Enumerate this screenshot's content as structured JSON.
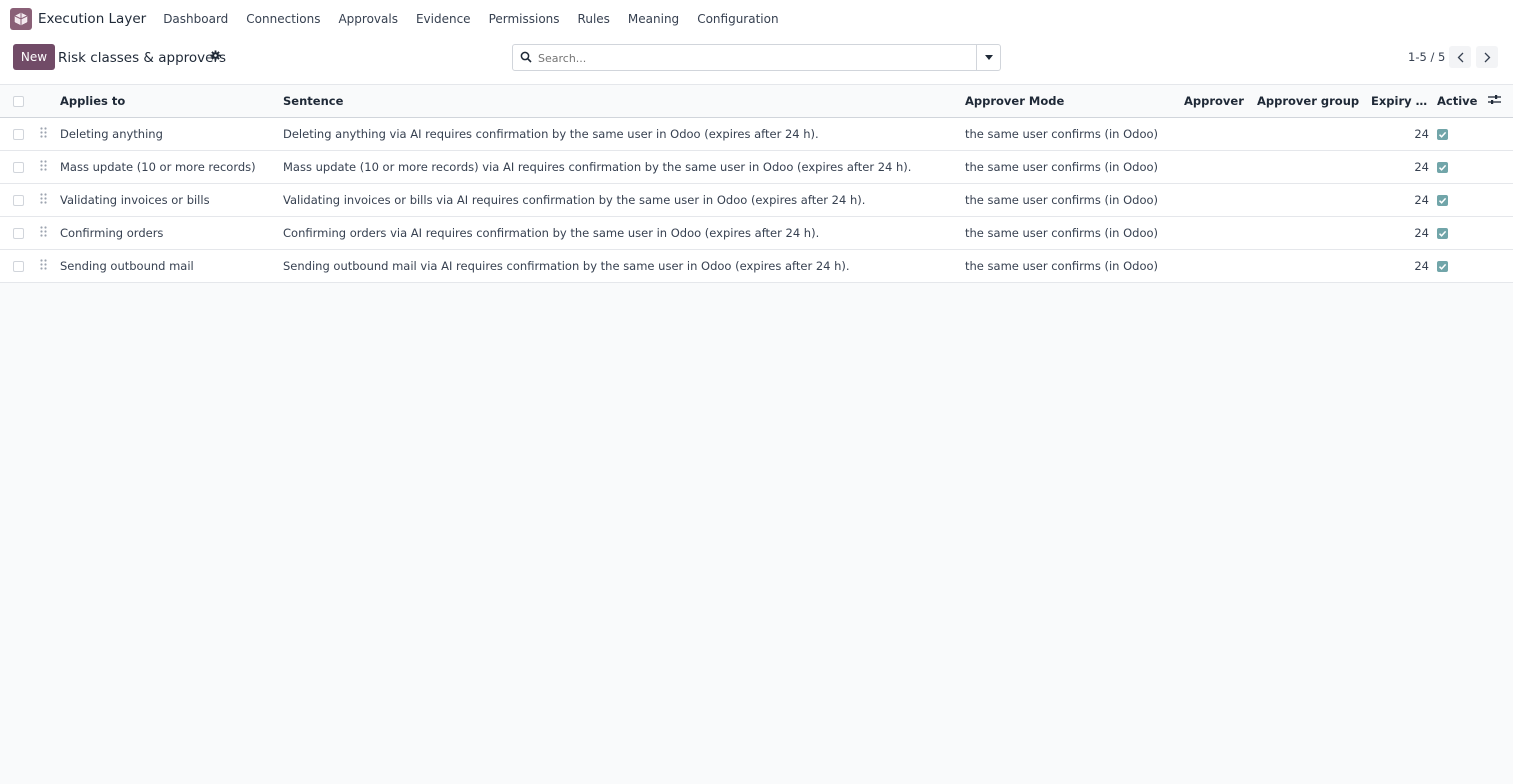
{
  "topbar": {
    "app_name": "Execution Layer",
    "menu": [
      "Dashboard",
      "Connections",
      "Approvals",
      "Evidence",
      "Permissions",
      "Rules",
      "Meaning",
      "Configuration"
    ]
  },
  "control": {
    "new_label": "New",
    "title": "Risk classes & approvers",
    "search_placeholder": "Search...",
    "pager": "1-5 / 5"
  },
  "table": {
    "columns": [
      "Applies to",
      "Sentence",
      "Approver Mode",
      "Approver",
      "Approver group",
      "Expiry H...",
      "Active"
    ],
    "rows": [
      {
        "applies_to": "Deleting anything",
        "sentence": "Deleting anything via AI requires confirmation by the same user in Odoo (expires after 24 h).",
        "approver_mode": "the same user confirms (in Odoo)",
        "approver": "",
        "approver_group": "",
        "expiry": "24",
        "active": true
      },
      {
        "applies_to": "Mass update (10 or more records)",
        "sentence": "Mass update (10 or more records) via AI requires confirmation by the same user in Odoo (expires after 24 h).",
        "approver_mode": "the same user confirms (in Odoo)",
        "approver": "",
        "approver_group": "",
        "expiry": "24",
        "active": true
      },
      {
        "applies_to": "Validating invoices or bills",
        "sentence": "Validating invoices or bills via AI requires confirmation by the same user in Odoo (expires after 24 h).",
        "approver_mode": "the same user confirms (in Odoo)",
        "approver": "",
        "approver_group": "",
        "expiry": "24",
        "active": true
      },
      {
        "applies_to": "Confirming orders",
        "sentence": "Confirming orders via AI requires confirmation by the same user in Odoo (expires after 24 h).",
        "approver_mode": "the same user confirms (in Odoo)",
        "approver": "",
        "approver_group": "",
        "expiry": "24",
        "active": true
      },
      {
        "applies_to": "Sending outbound mail",
        "sentence": "Sending outbound mail via AI requires confirmation by the same user in Odoo (expires after 24 h).",
        "approver_mode": "the same user confirms (in Odoo)",
        "approver": "",
        "approver_group": "",
        "expiry": "24",
        "active": true
      }
    ]
  },
  "colors": {
    "brand": "#714b67",
    "check": "#71a5a9"
  }
}
